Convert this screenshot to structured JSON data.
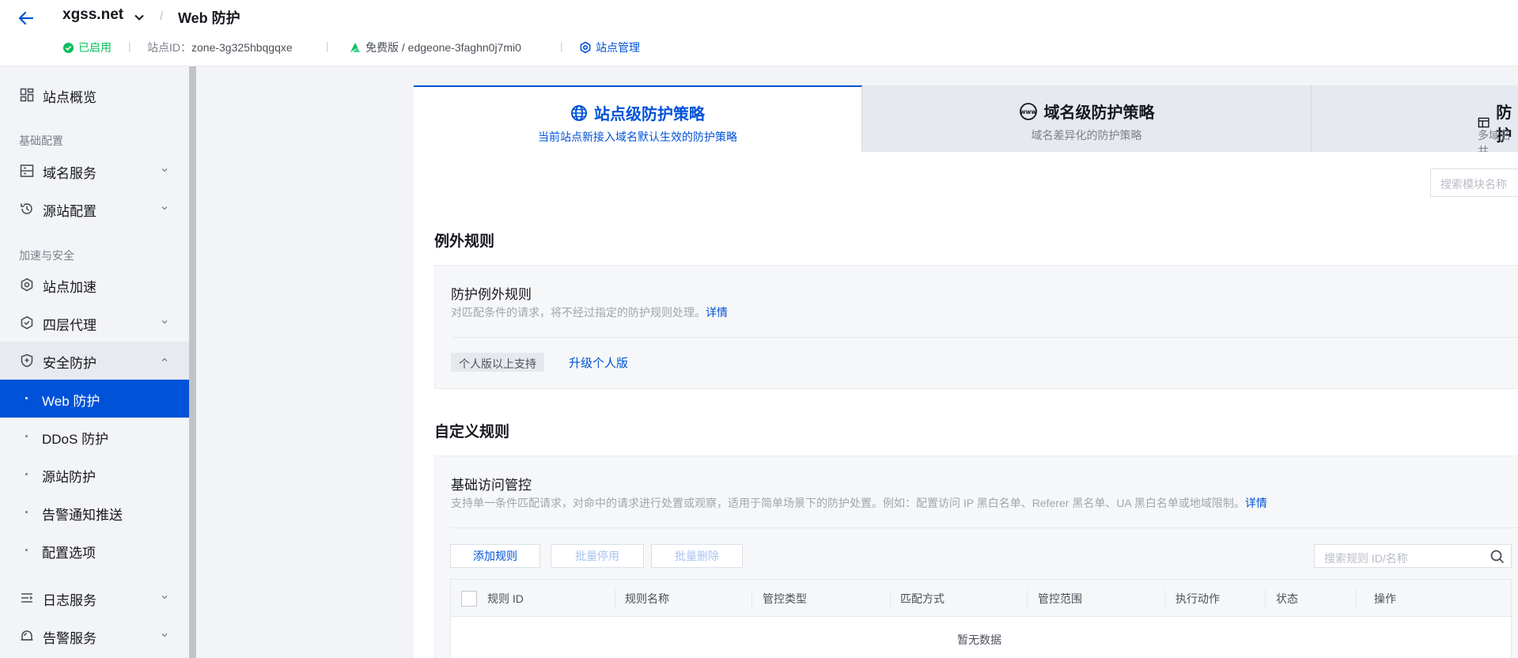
{
  "header": {
    "site_name": "xgss.net",
    "crumb_sep": "/",
    "page_title": "Web 防护",
    "status": "已启用",
    "site_id_label": "站点ID：",
    "site_id": "zone-3g325hbqgqxe",
    "plan": "免费版 / edgeone-3faghn0j7mi0",
    "site_manage": "站点管理",
    "sep": "|"
  },
  "sidebar": {
    "overview": "站点概览",
    "group_basic": "基础配置",
    "domain_service": "域名服务",
    "origin_config": "源站配置",
    "group_accel": "加速与安全",
    "site_accel": "站点加速",
    "l4_proxy": "四层代理",
    "security": "安全防护",
    "sub_items": [
      "Web 防护",
      "DDoS 防护",
      "源站防护",
      "告警通知推送",
      "配置选项"
    ],
    "log_service": "日志服务",
    "alert_service": "告警服务"
  },
  "tabs": [
    {
      "title": "站点级防护策略",
      "subtitle": "当前站点新接入域名默认生效的防护策略"
    },
    {
      "title": "域名级防护策略",
      "subtitle": "域名差异化的防护策略"
    },
    {
      "title": "防护",
      "subtitle": "多域名共"
    }
  ],
  "module_search_placeholder": "搜索模块名称",
  "exception": {
    "section_title": "例外规则",
    "card_title": "防护例外规则",
    "desc": "对匹配条件的请求，将不经过指定的防护规则处理。",
    "detail_link": "详情",
    "tag": "个人版以上支持",
    "upgrade": "升级个人版"
  },
  "custom": {
    "section_title": "自定义规则",
    "card_title": "基础访问管控",
    "desc": "支持单一条件匹配请求，对命中的请求进行处置或观察，适用于简单场景下的防护处置。例如：配置访问 IP 黑白名单、Referer 黑名单、UA 黑白名单或地域限制。",
    "detail_link": "详情",
    "add_rule": "添加规则",
    "batch_disable": "批量停用",
    "batch_delete": "批量删除",
    "search_placeholder": "搜索规则 ID/名称",
    "columns": [
      "规则 ID",
      "规则名称",
      "管控类型",
      "匹配方式",
      "管控范围",
      "执行动作",
      "状态",
      "操作"
    ],
    "empty": "暂无数据"
  },
  "colors": {
    "primary": "#0052d9",
    "success": "#0abf5b"
  }
}
